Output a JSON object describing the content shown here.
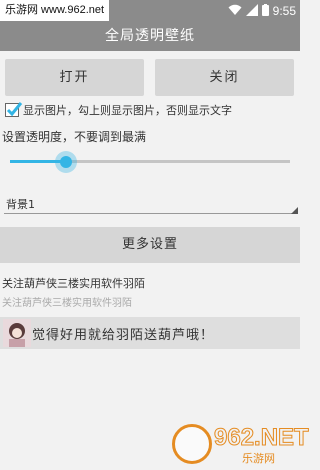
{
  "status_bar": {
    "watermark_text": "乐游网 www.962.net",
    "time": "9:55",
    "icons": [
      "wifi-icon",
      "signal-icon",
      "battery-icon"
    ]
  },
  "title_bar": {
    "title": "全局透明壁纸"
  },
  "buttons": {
    "on_label": "打开",
    "off_label": "关闭"
  },
  "checkbox": {
    "checked": true,
    "label": "显示图片，勾上则显示图片，否则显示文字"
  },
  "opacity": {
    "label": "设置透明度，不要调到最满",
    "level_fraction": 0.2
  },
  "background_spinner": {
    "selected": "背景1"
  },
  "more_settings": {
    "label": "更多设置"
  },
  "follow": {
    "primary": "关注葫芦侠三楼实用软件羽陌",
    "secondary": "关注葫芦侠三楼实用软件羽陌"
  },
  "banner": {
    "text": "觉得好用就给羽陌送葫芦哦！"
  },
  "watermark_logo": {
    "main": "962.NET",
    "sub": "乐游网"
  },
  "colors": {
    "title_bar": "#8b8b8b",
    "button_bg": "#d6d6d6",
    "slider_accent": "#33b5e5",
    "page_bg": "#f2f2f2"
  }
}
